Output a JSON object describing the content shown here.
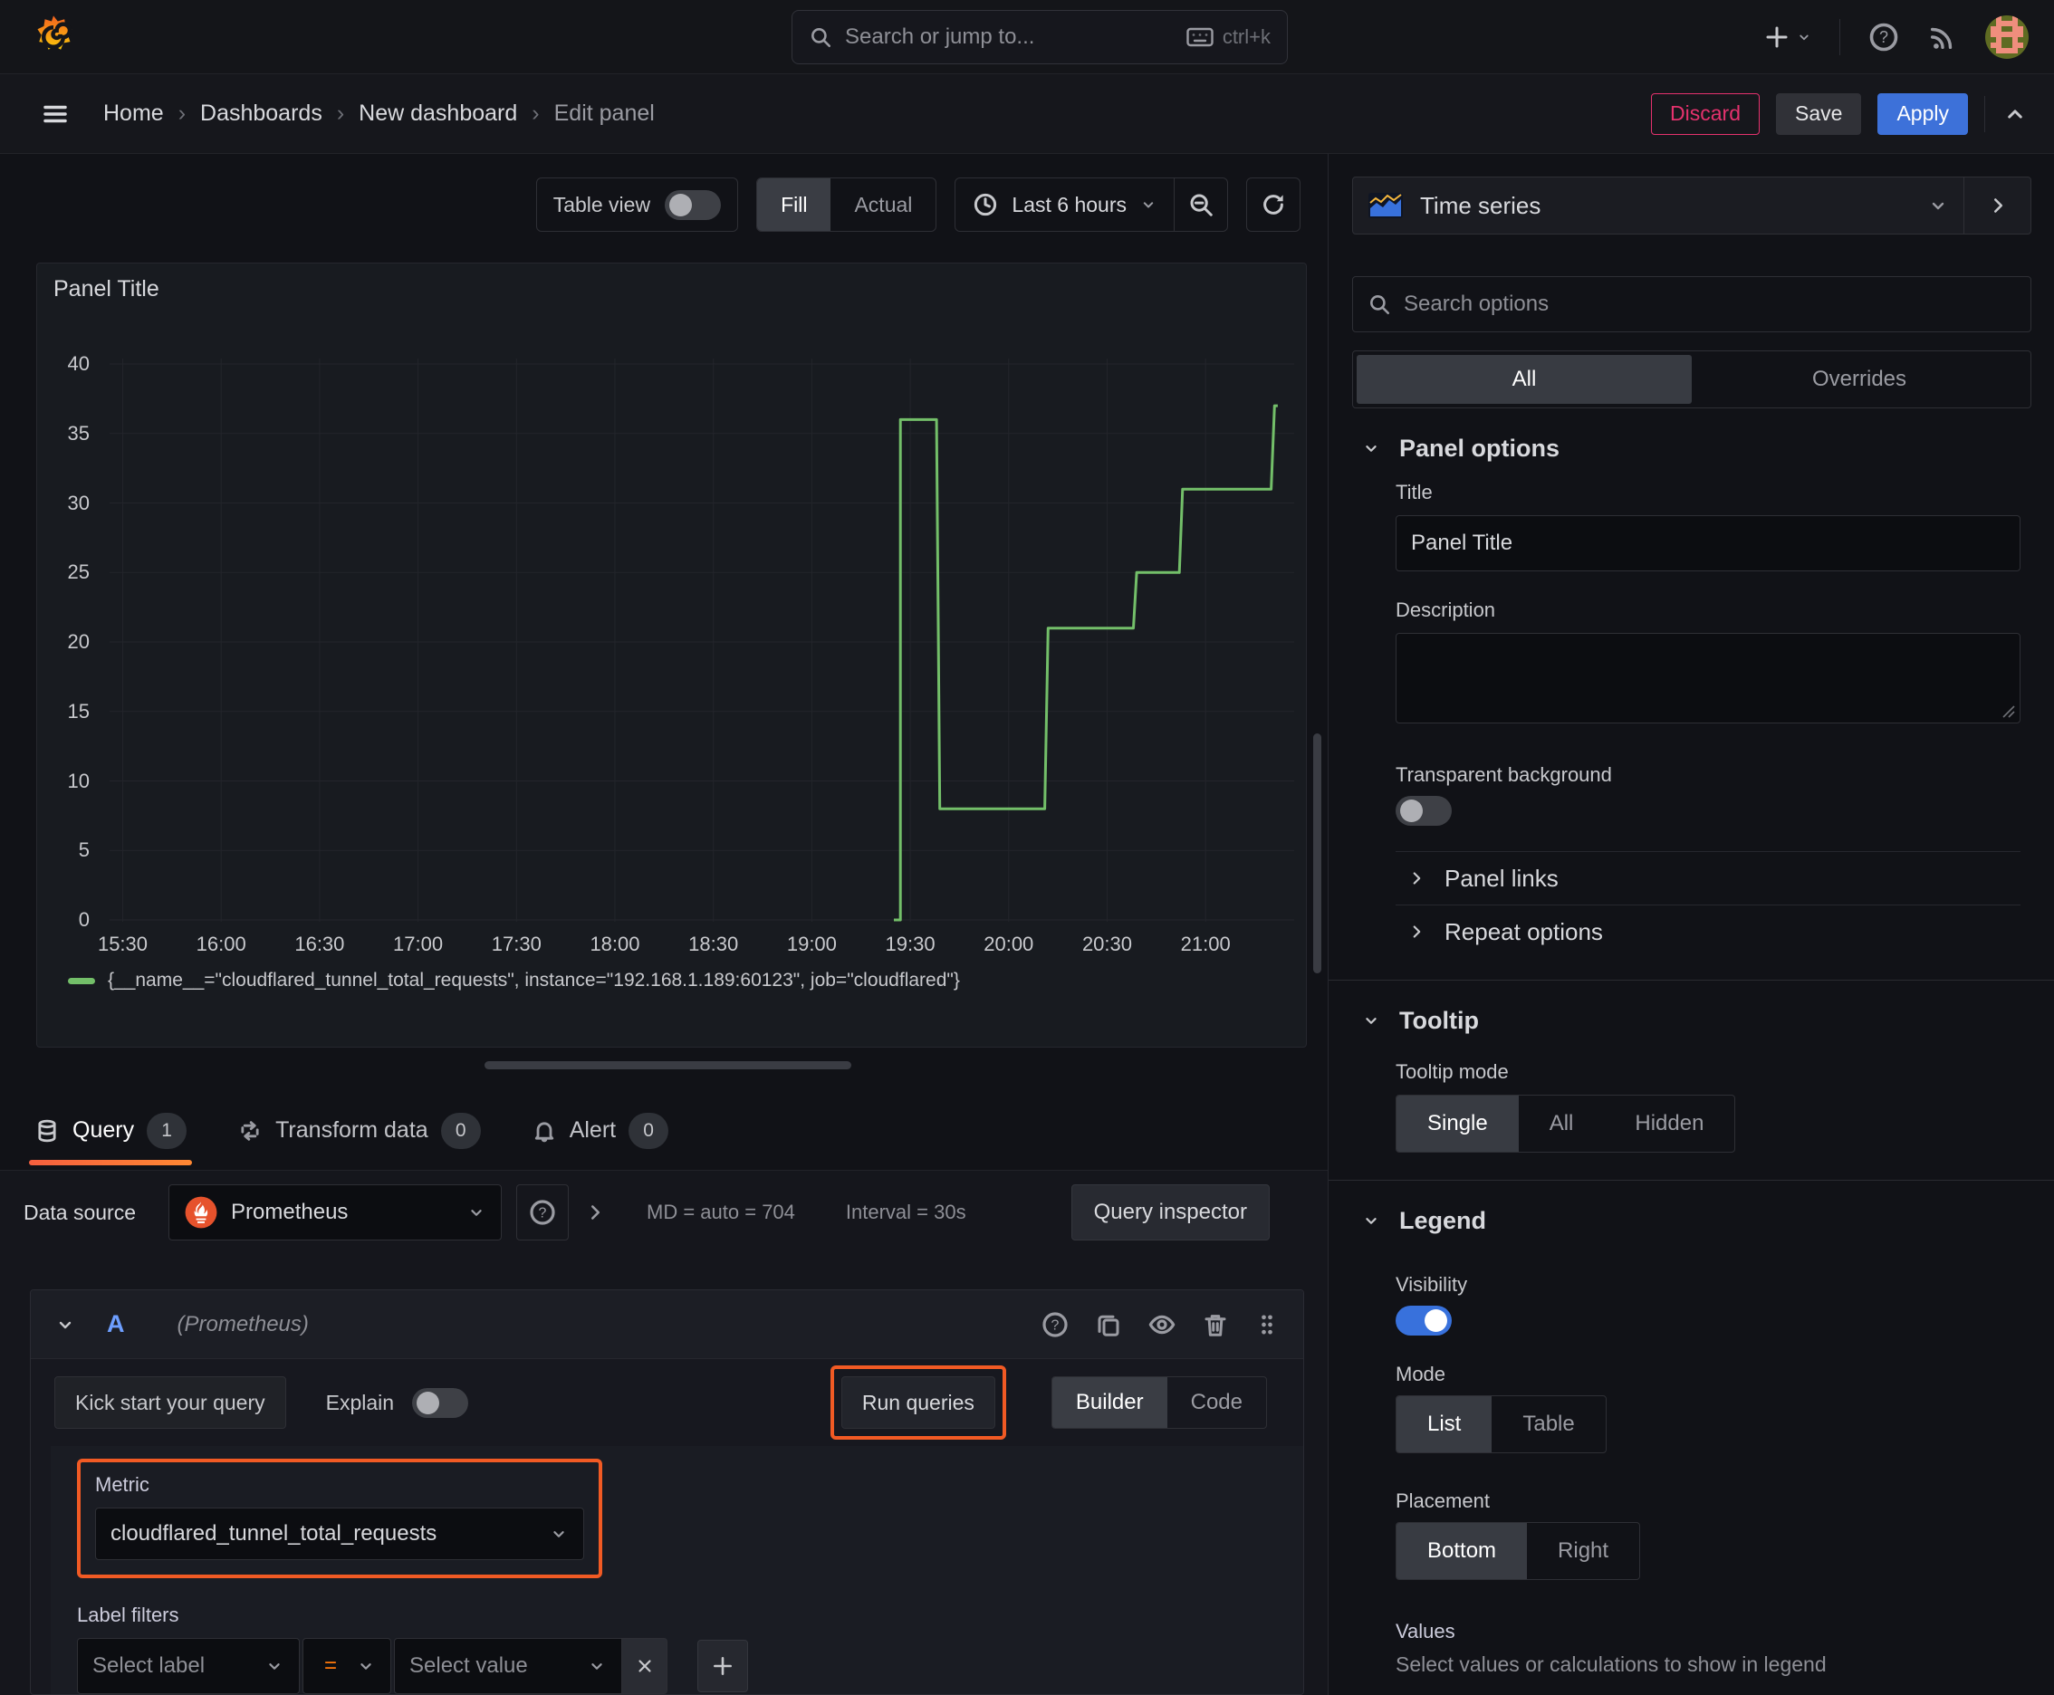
{
  "topnav": {
    "search": {
      "placeholder": "Search or jump to...",
      "shortcut": "ctrl+k"
    }
  },
  "breadcrumb_bar": {
    "separator": "›",
    "items": [
      "Home",
      "Dashboards",
      "New dashboard",
      "Edit panel"
    ],
    "discard_label": "Discard",
    "save_label": "Save",
    "apply_label": "Apply"
  },
  "toolbar": {
    "table_view_label": "Table view",
    "fill_label": "Fill",
    "actual_label": "Actual",
    "time_range_label": "Last 6 hours"
  },
  "panel": {
    "title": "Panel Title",
    "legend_series": "{__name__=\"cloudflared_tunnel_total_requests\", instance=\"192.168.1.189:60123\", job=\"cloudflared\"}"
  },
  "chart_data": {
    "type": "line",
    "line_style": "stepped",
    "title": "Panel Title",
    "x_ticks": [
      "15:30",
      "16:00",
      "16:30",
      "17:00",
      "17:30",
      "18:00",
      "18:30",
      "19:00",
      "19:30",
      "20:00",
      "20:30",
      "21:00"
    ],
    "y_ticks": [
      0,
      5,
      10,
      15,
      20,
      25,
      30,
      35,
      40
    ],
    "x_range": [
      "15:26",
      "21:27"
    ],
    "ylim": [
      0,
      40
    ],
    "grid": true,
    "legend_position": "bottom",
    "series": [
      {
        "name": "{__name__=\"cloudflared_tunnel_total_requests\", instance=\"192.168.1.189:60123\", job=\"cloudflared\"}",
        "color": "#73BF69",
        "points": [
          [
            "19:25",
            0
          ],
          [
            "19:27",
            0
          ],
          [
            "19:27",
            36
          ],
          [
            "19:38",
            36
          ],
          [
            "19:39",
            8
          ],
          [
            "20:11",
            8
          ],
          [
            "20:12",
            21
          ],
          [
            "20:38",
            21
          ],
          [
            "20:39",
            25
          ],
          [
            "20:52",
            25
          ],
          [
            "20:53",
            31
          ],
          [
            "21:20",
            31
          ],
          [
            "21:21",
            37
          ],
          [
            "21:22",
            37
          ]
        ]
      }
    ]
  },
  "tabs": [
    {
      "label": "Query",
      "count": "1"
    },
    {
      "label": "Transform data",
      "count": "0"
    },
    {
      "label": "Alert",
      "count": "0"
    }
  ],
  "query_header": {
    "datasource_label": "Data source",
    "datasource_value": "Prometheus",
    "stats": "MD = auto = 704",
    "interval": "Interval = 30s",
    "inspector_label": "Query inspector"
  },
  "query_row": {
    "ref_id": "A",
    "datasource_hint": "(Prometheus)"
  },
  "query_toolbar": {
    "kickstart_label": "Kick start your query",
    "explain_label": "Explain",
    "run_label": "Run queries",
    "builder_label": "Builder",
    "code_label": "Code"
  },
  "metric": {
    "label": "Metric",
    "value": "cloudflared_tunnel_total_requests"
  },
  "label_filters": {
    "label": "Label filters",
    "select_label_placeholder": "Select label",
    "operator": "=",
    "select_value_placeholder": "Select value"
  },
  "options_pane": {
    "viz_name": "Time series",
    "search_placeholder": "Search options",
    "tabs": {
      "all": "All",
      "overrides": "Overrides"
    },
    "panel_options": {
      "title": "Panel options",
      "title_label": "Title",
      "title_value": "Panel Title",
      "description_label": "Description",
      "transparent_label": "Transparent background"
    },
    "collapsed": [
      "Panel links",
      "Repeat options"
    ],
    "tooltip": {
      "title": "Tooltip",
      "mode_label": "Tooltip mode",
      "options": [
        "Single",
        "All",
        "Hidden"
      ],
      "active": "Single"
    },
    "legend": {
      "title": "Legend",
      "visibility_label": "Visibility",
      "mode_label": "Mode",
      "mode_options": [
        "List",
        "Table"
      ],
      "mode_active": "List",
      "placement_label": "Placement",
      "placement_options": [
        "Bottom",
        "Right"
      ],
      "placement_active": "Bottom",
      "values_label": "Values",
      "values_hint": "Select values or calculations to show in legend"
    }
  },
  "colors": {
    "accent_orange": "#FF780A",
    "annotation_orange": "#F15A24",
    "series_green": "#73BF69",
    "primary_blue": "#3D71D9",
    "toggle_on_blue": "#3871DC",
    "discard_red": "#E5326E"
  },
  "icons": {
    "grafana-logo": "flame-spiral",
    "search-icon": "magnifier",
    "keyboard-icon": "keyboard",
    "plus-icon": "+",
    "help-icon": "? circle",
    "rss-icon": "broadcast arcs",
    "avatar": "pixel-art",
    "menu-icon": "hamburger",
    "chevron-down-icon": "v",
    "chevron-right-icon": ">",
    "chevron-up-icon": "^",
    "clock-icon": "clock",
    "zoom-out-icon": "magnifier-minus",
    "refresh-icon": "circular-arrow",
    "database-icon": "cylinder",
    "transform-icon": "cycle-arrows",
    "bell-icon": "bell",
    "copy-icon": "two pages",
    "eye-icon": "eye",
    "trash-icon": "trash can",
    "drag-handle-icon": "dot grid",
    "close-icon": "x",
    "prometheus-icon": "torch in circle",
    "timeseries-viz-icon": "mini area chart",
    "resize-handle-icon": "diagonal grip"
  }
}
